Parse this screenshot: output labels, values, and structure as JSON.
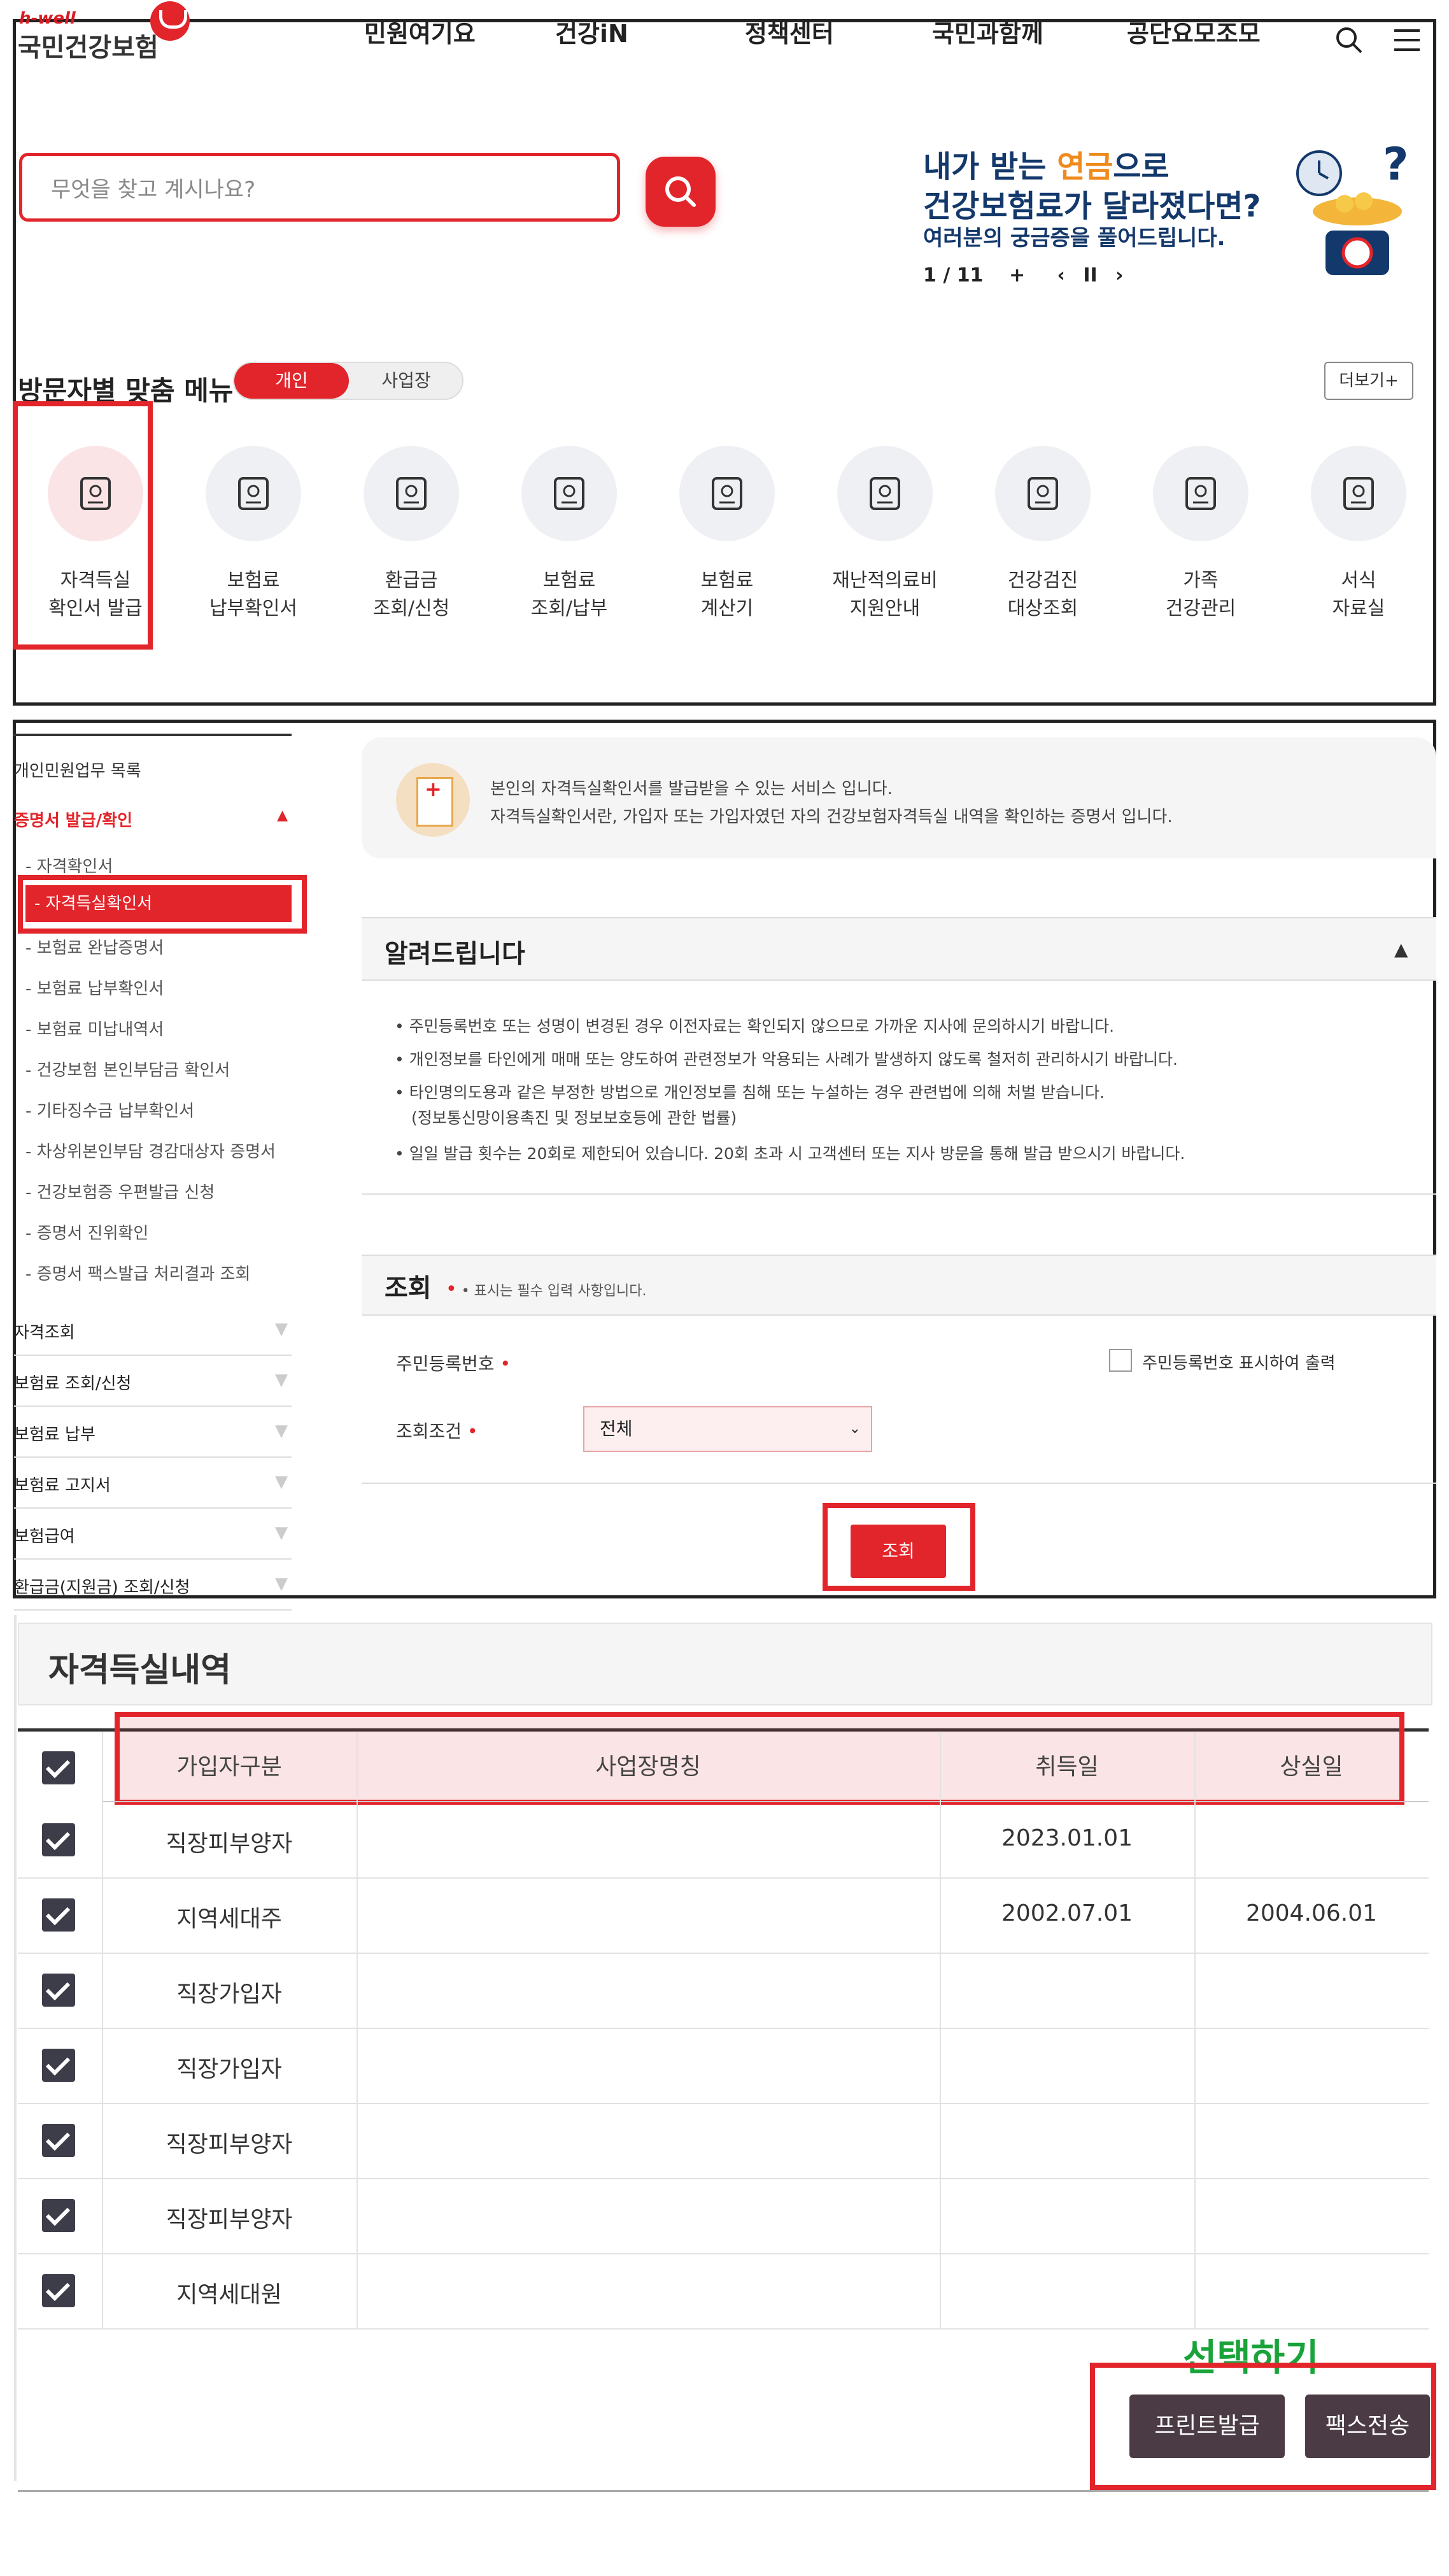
{
  "header": {
    "logo_small": "h-well",
    "logo_main": "국민건강보험",
    "nav": [
      "민원여기요",
      "건강iN",
      "정책센터",
      "국민과함께",
      "공단요모조모"
    ]
  },
  "search": {
    "placeholder": "무엇을 찾고 계시나요?"
  },
  "banner": {
    "line1_a": "내가 받는 ",
    "line1_b": "연금",
    "line1_c": "으로",
    "line2": "건강보험료가 달라졌다면?",
    "line3": "여러분의 궁금증을 풀어드립니다.",
    "page": "1",
    "total": "11",
    "play_label": "+",
    "prev": "‹",
    "pause": "II",
    "next": "›"
  },
  "custom_menu": {
    "title": "방문자별 맞춤 메뉴",
    "toggle_on": "개인",
    "toggle_off": "사업장",
    "more": "더보기+",
    "items": [
      {
        "label": "자격득실\n확인서 발급",
        "icon": "id-card-heart-icon"
      },
      {
        "label": "보험료\n납부확인서",
        "icon": "document-search-icon"
      },
      {
        "label": "환급금\n조회/신청",
        "icon": "monitor-won-icon"
      },
      {
        "label": "보험료\n조회/납부",
        "icon": "bill-heart-icon"
      },
      {
        "label": "보험료\n계산기",
        "icon": "calculator-icon"
      },
      {
        "label": "재난적의료비\n지원안내",
        "icon": "won-support-icon"
      },
      {
        "label": "건강검진\n대상조회",
        "icon": "people-search-icon"
      },
      {
        "label": "가족\n건강관리",
        "icon": "family-heart-icon"
      },
      {
        "label": "서식\n자료실",
        "icon": "form-check-icon"
      }
    ]
  },
  "sidebar": {
    "top": "개인민원업무 목록",
    "section": "증명서 발급/확인",
    "sub": [
      "- 자격확인서",
      "- 자격득실확인서",
      "- 보험료 완납증명서",
      "- 보험료 납부확인서",
      "- 보험료 미납내역서",
      "- 건강보험 본인부담금 확인서",
      "- 기타징수금 납부확인서",
      "- 차상위본인부담 경감대상자 증명서",
      "- 건강보험증 우편발급 신청",
      "- 증명서 진위확인",
      "- 증명서 팩스발급 처리결과 조회"
    ],
    "groups": [
      "자격조회",
      "보험료 조회/신청",
      "보험료 납부",
      "보험료 고지서",
      "보험급여",
      "환급금(지원금) 조회/신청"
    ],
    "arrow": "▼"
  },
  "info": {
    "line1": "본인의 자격득실확인서를 발급받을 수 있는 서비스 입니다.",
    "line2": "자격득실확인서란, 가입자 또는 가입자였던 자의 건강보험자격득실 내역을 확인하는 증명서 입니다."
  },
  "notice": {
    "title": "알려드립니다",
    "caret": "▲",
    "lines": [
      "• 주민등록번호 또는 성명이 변경된 경우 이전자료는 확인되지 않으므로 가까운 지사에 문의하시기 바랍니다.",
      "• 개인정보를 타인에게 매매 또는 양도하여 관련정보가 악용되는 사례가 발생하지 않도록 철저히 관리하시기 바랍니다.",
      "• 타인명의도용과 같은 부정한 방법으로 개인정보를 침해 또는 누설하는 경우 관련법에 의해 처벌 받습니다.",
      "(정보통신망이용촉진 및 정보보호등에 관한 법률)",
      "• 일일 발급 횟수는 20회로 제한되어 있습니다. 20회 초과 시 고객센터 또는 지사 방문을 통해 발급 받으시기 바랍니다."
    ]
  },
  "query": {
    "title": "조회",
    "note": "• 표시는 필수 입력 사항입니다.",
    "resident_label": "주민등록번호",
    "show_resident": "주민등록번호 표시하여 출력",
    "condition_label": "조회조건",
    "condition_value": "전체",
    "required_mark": "•",
    "button": "조회"
  },
  "history": {
    "title": "자격득실내역",
    "columns": [
      "가입자구분",
      "사업장명칭",
      "취득일",
      "상실일"
    ],
    "rows": [
      {
        "type": "직장피부양자",
        "name": "",
        "acquired": "2023.01.01",
        "lost": ""
      },
      {
        "type": "지역세대주",
        "name": "",
        "acquired": "2002.07.01",
        "lost": "2004.06.01"
      },
      {
        "type": "직장가입자",
        "name": "",
        "acquired": "",
        "lost": ""
      },
      {
        "type": "직장가입자",
        "name": "",
        "acquired": "",
        "lost": ""
      },
      {
        "type": "직장피부양자",
        "name": "",
        "acquired": "",
        "lost": ""
      },
      {
        "type": "직장피부양자",
        "name": "",
        "acquired": "",
        "lost": ""
      },
      {
        "type": "지역세대원",
        "name": "",
        "acquired": "",
        "lost": ""
      }
    ],
    "select_text": "선택하기",
    "print_button": "프린트발급",
    "fax_button": "팩스전송"
  },
  "colors": {
    "accent": "#e2252b",
    "navy": "#13386b",
    "action": "#4b3b45",
    "green": "#1aa33a"
  }
}
